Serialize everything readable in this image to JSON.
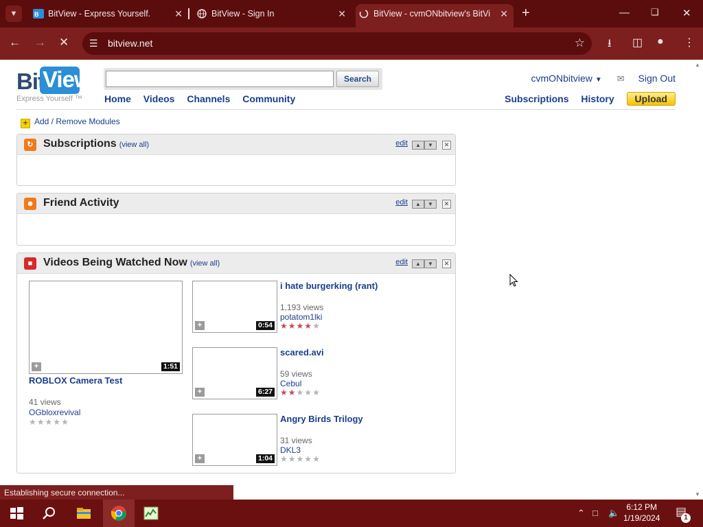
{
  "browser": {
    "tabs": [
      {
        "title": "BitView - Express Yourself.",
        "active": false
      },
      {
        "title": "BitView - Sign In",
        "active": false
      },
      {
        "title": "BitView - cvmONbitview's BitVi",
        "active": true
      }
    ],
    "address": "bitview.net",
    "status": "Establishing secure connection..."
  },
  "header": {
    "logo_bit": "Bit",
    "logo_view": "View",
    "tagline": "Express Yourself ™",
    "search_value": "",
    "search_button": "Search",
    "nav": [
      "Home",
      "Videos",
      "Channels",
      "Community"
    ],
    "username": "cvmONbitview",
    "sign_out": "Sign Out",
    "subnav": [
      "Subscriptions",
      "History"
    ],
    "upload": "Upload"
  },
  "add_modules": "Add / Remove Modules",
  "modules": {
    "subscriptions": {
      "title": "Subscriptions",
      "view_all": "(view all)",
      "edit": "edit"
    },
    "friends": {
      "title": "Friend Activity",
      "edit": "edit"
    },
    "watching": {
      "title": "Videos Being Watched Now",
      "view_all": "(view all)",
      "edit": "edit"
    }
  },
  "videos": [
    {
      "title": "ROBLOX Camera Test",
      "views": "41 views",
      "user": "OGbloxrevival",
      "duration": "1:51",
      "rating": 0
    },
    {
      "title": "i hate burgerking (rant)",
      "views": "1,193 views",
      "user": "potatom1lki",
      "duration": "0:54",
      "rating": 3.5
    },
    {
      "title": "scared.avi",
      "views": "59 views",
      "user": "Cebul",
      "duration": "6:27",
      "rating": 2
    },
    {
      "title": "Angry Birds Trilogy",
      "views": "31 views",
      "user": "DKL3",
      "duration": "1:04",
      "rating": 0
    }
  ],
  "taskbar": {
    "time": "6:12 PM",
    "date": "1/19/2024",
    "notifications": "1"
  },
  "colors": {
    "chrome_frame": "#7d1f1f",
    "chrome_tabbar": "#5b0d0d",
    "link_blue": "#1a3d8c",
    "upload_yellow": "#f6c400",
    "star_red": "#c9485b"
  }
}
